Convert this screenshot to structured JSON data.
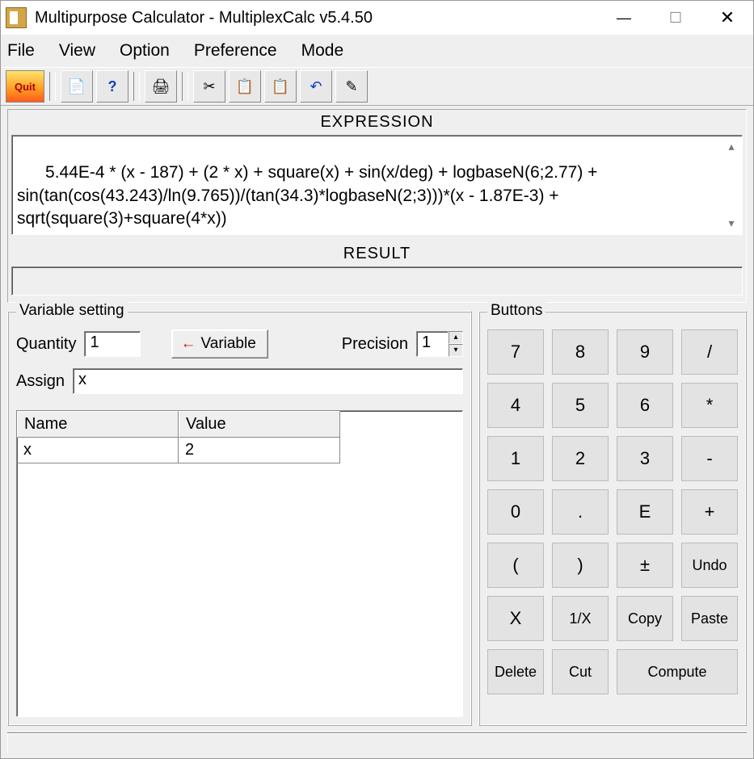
{
  "window": {
    "title": "Multipurpose Calculator - MultiplexCalc v5.4.50"
  },
  "menu": {
    "file": "File",
    "view": "View",
    "option": "Option",
    "preference": "Preference",
    "mode": "Mode"
  },
  "toolbar": {
    "quit": "Quit"
  },
  "expression": {
    "heading": "EXPRESSION",
    "value": "5.44E-4 * (x - 187) + (2 * x) + square(x) + sin(x/deg) + logbaseN(6;2.77) + sin(tan(cos(43.243)/ln(9.765))/(tan(34.3)*logbaseN(2;3)))*(x - 1.87E-3) + sqrt(square(3)+square(4*x))"
  },
  "result": {
    "heading": "RESULT",
    "value": ""
  },
  "variable": {
    "legend": "Variable setting",
    "quantity_label": "Quantity",
    "quantity_value": "1",
    "variable_button": "Variable",
    "precision_label": "Precision",
    "precision_value": "1",
    "assign_label": "Assign",
    "assign_value": "x",
    "table": {
      "col_name": "Name",
      "col_value": "Value",
      "rows": [
        {
          "name": "x",
          "value": "2"
        }
      ]
    }
  },
  "buttons": {
    "legend": "Buttons",
    "k7": "7",
    "k8": "8",
    "k9": "9",
    "kdiv": "/",
    "k4": "4",
    "k5": "5",
    "k6": "6",
    "kmul": "*",
    "k1": "1",
    "k2": "2",
    "k3": "3",
    "kminus": "-",
    "k0": "0",
    "kdot": ".",
    "kE": "E",
    "kplus": "+",
    "klp": "(",
    "krp": ")",
    "kpm": "±",
    "kundo": "Undo",
    "kx": "X",
    "kinv": "1/X",
    "kcopy": "Copy",
    "kpaste": "Paste",
    "kdel": "Delete",
    "kcut": "Cut",
    "kcompute": "Compute"
  }
}
